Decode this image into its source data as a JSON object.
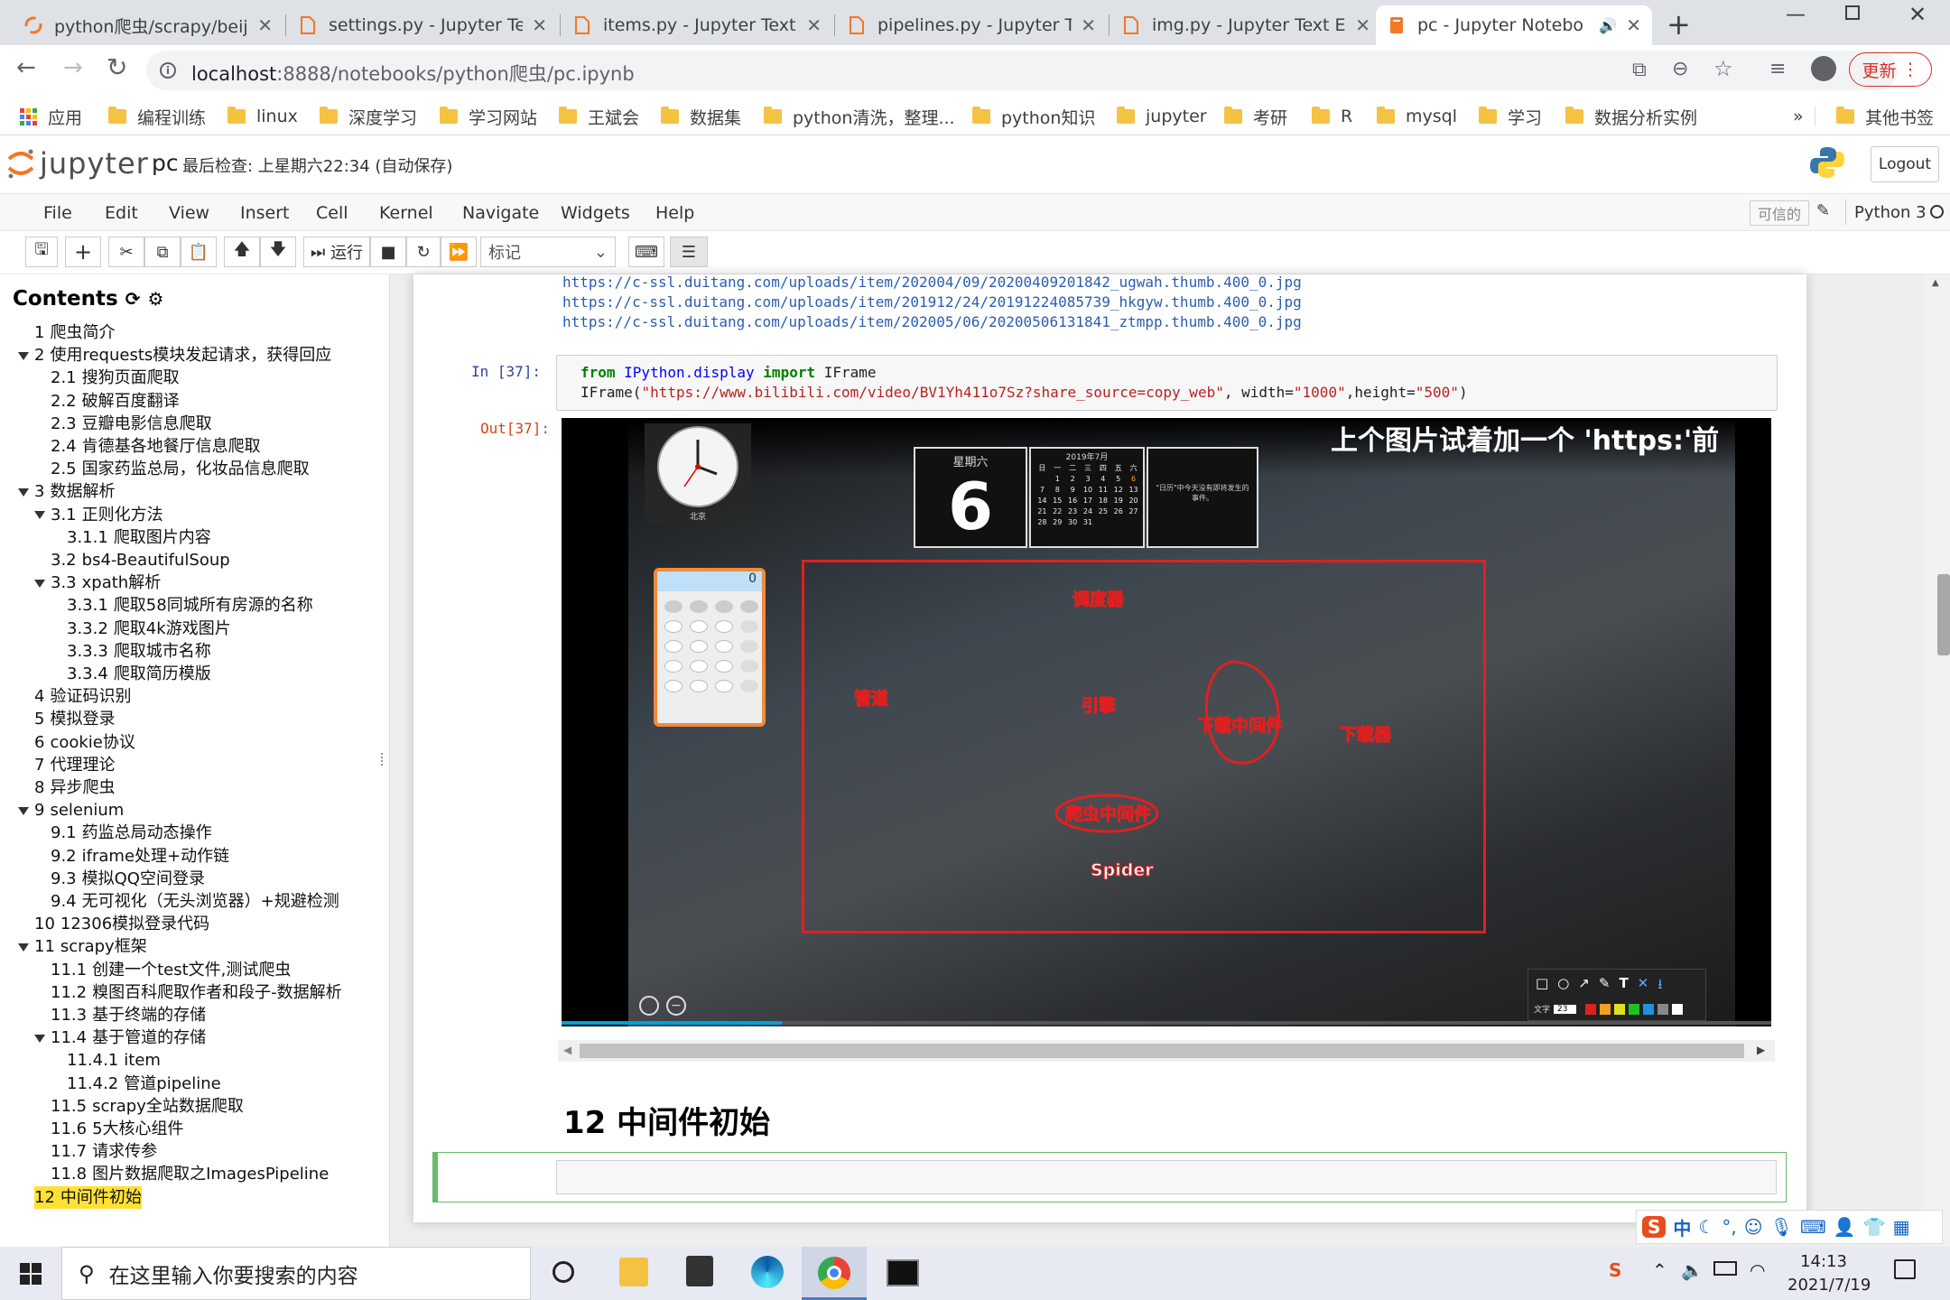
{
  "browser": {
    "tabs": [
      {
        "title": "python爬虫/scrapy/beiji",
        "icon": "jupyter-tab-icon"
      },
      {
        "title": "settings.py - Jupyter Tex",
        "icon": "file-tab-icon"
      },
      {
        "title": "items.py - Jupyter Text E",
        "icon": "file-tab-icon"
      },
      {
        "title": "pipelines.py - Jupyter Te",
        "icon": "file-tab-icon"
      },
      {
        "title": "img.py - Jupyter Text Ec",
        "icon": "file-tab-icon"
      },
      {
        "title": "pc - Jupyter Notebo",
        "icon": "notebook-tab-icon",
        "active": true
      }
    ],
    "new_tab": "+",
    "url_host": "localhost",
    "url_path": ":8888/notebooks/python爬虫/pc.ipynb",
    "update_button": "更新",
    "bookmarks": [
      "应用",
      "编程训练",
      "linux",
      "深度学习",
      "学习网站",
      "王斌会",
      "数据集",
      "python清洗，整理...",
      "python知识",
      "jupyter",
      "考研",
      "R",
      "mysql",
      "学习",
      "数据分析实例"
    ],
    "more_bookmarks": "»",
    "other_bookmarks": "其他书签"
  },
  "jupyter": {
    "logo_text": "jupyter",
    "notebook_name": "pc",
    "checkpoint": "最后检查: 上星期六22:34",
    "autosave": "(自动保存)",
    "logout": "Logout",
    "menu": [
      "File",
      "Edit",
      "View",
      "Insert",
      "Cell",
      "Kernel",
      "Navigate",
      "Widgets",
      "Help"
    ],
    "trusted": "可信的",
    "kernel": "Python 3",
    "run_label": "运行",
    "cell_type": "标记"
  },
  "toc": {
    "title": "Contents",
    "items": [
      {
        "num": "1",
        "label": "爬虫简介",
        "level": 0
      },
      {
        "num": "2",
        "label": "使用requests模块发起请求，获得回应",
        "level": 0,
        "expanded": true
      },
      {
        "num": "2.1",
        "label": "搜狗页面爬取",
        "level": 1
      },
      {
        "num": "2.2",
        "label": "破解百度翻译",
        "level": 1
      },
      {
        "num": "2.3",
        "label": "豆瓣电影信息爬取",
        "level": 1
      },
      {
        "num": "2.4",
        "label": "肯德基各地餐厅信息爬取",
        "level": 1
      },
      {
        "num": "2.5",
        "label": "国家药监总局，化妆品信息爬取",
        "level": 1
      },
      {
        "num": "3",
        "label": "数据解析",
        "level": 0,
        "expanded": true
      },
      {
        "num": "3.1",
        "label": "正则化方法",
        "level": 1,
        "expanded": true
      },
      {
        "num": "3.1.1",
        "label": "爬取图片内容",
        "level": 2
      },
      {
        "num": "3.2",
        "label": "bs4-BeautifulSoup",
        "level": 1
      },
      {
        "num": "3.3",
        "label": "xpath解析",
        "level": 1,
        "expanded": true
      },
      {
        "num": "3.3.1",
        "label": "爬取58同城所有房源的名称",
        "level": 2
      },
      {
        "num": "3.3.2",
        "label": "爬取4k游戏图片",
        "level": 2
      },
      {
        "num": "3.3.3",
        "label": "爬取城市名称",
        "level": 2
      },
      {
        "num": "3.3.4",
        "label": "爬取简历模版",
        "level": 2
      },
      {
        "num": "4",
        "label": "验证码识别",
        "level": 0
      },
      {
        "num": "5",
        "label": "模拟登录",
        "level": 0
      },
      {
        "num": "6",
        "label": "cookie协议",
        "level": 0
      },
      {
        "num": "7",
        "label": "代理理论",
        "level": 0
      },
      {
        "num": "8",
        "label": "异步爬虫",
        "level": 0
      },
      {
        "num": "9",
        "label": "selenium",
        "level": 0,
        "expanded": true
      },
      {
        "num": "9.1",
        "label": "药监总局动态操作",
        "level": 1
      },
      {
        "num": "9.2",
        "label": "iframe处理+动作链",
        "level": 1
      },
      {
        "num": "9.3",
        "label": "模拟QQ空间登录",
        "level": 1
      },
      {
        "num": "9.4",
        "label": "无可视化（无头浏览器）+规避检测",
        "level": 1
      },
      {
        "num": "10",
        "label": "12306模拟登录代码",
        "level": 0
      },
      {
        "num": "11",
        "label": "scrapy框架",
        "level": 0,
        "expanded": true
      },
      {
        "num": "11.1",
        "label": "创建一个test文件,测试爬虫",
        "level": 1
      },
      {
        "num": "11.2",
        "label": "糗图百科爬取作者和段子-数据解析",
        "level": 1
      },
      {
        "num": "11.3",
        "label": "基于终端的存储",
        "level": 1
      },
      {
        "num": "11.4",
        "label": "基于管道的存储",
        "level": 1,
        "expanded": true
      },
      {
        "num": "11.4.1",
        "label": "item",
        "level": 2
      },
      {
        "num": "11.4.2",
        "label": "管道pipeline",
        "level": 2
      },
      {
        "num": "11.5",
        "label": "scrapy全站数据爬取",
        "level": 1
      },
      {
        "num": "11.6",
        "label": "5大核心组件",
        "level": 1
      },
      {
        "num": "11.7",
        "label": "请求传参",
        "level": 1
      },
      {
        "num": "11.8",
        "label": "图片数据爬取之ImagesPipeline",
        "level": 1
      },
      {
        "num": "12",
        "label": "中间件初始",
        "level": 0,
        "highlight": true
      }
    ]
  },
  "notebook": {
    "output_links": [
      "https://c-ssl.duitang.com/uploads/item/202004/09/20200409201842_ugwah.thumb.400_0.jpg",
      "https://c-ssl.duitang.com/uploads/item/201912/24/20191224085739_hkgyw.thumb.400_0.jpg",
      "https://c-ssl.duitang.com/uploads/item/202005/06/20200506131841_ztmpp.thumb.400_0.jpg"
    ],
    "in_prompt": "In  [37]:",
    "out_prompt": "Out[37]:",
    "code_kw_from": "from",
    "code_mod": " IPython.display ",
    "code_kw_import": "import",
    "code_cls": " IFrame",
    "code_line2_a": "IFrame(",
    "code_line2_str": "\"https://www.bilibili.com/video/BV1Yh411o7Sz?share_source=copy_web\"",
    "code_line2_b": ", width=",
    "code_line2_w": "\"1000\"",
    "code_line2_c": ",height=",
    "code_line2_h": "\"500\"",
    "code_line2_d": ")",
    "heading": "12  中间件初始",
    "video": {
      "caption": "上个图片试着加一个 'https:'前",
      "weekday": "星期六",
      "day": "6",
      "calendar_title": "2019年7月",
      "calendar_days": [
        "日",
        "一",
        "二",
        "三",
        "四",
        "五",
        "六",
        "",
        "1",
        "2",
        "3",
        "4",
        "5",
        "6",
        "7",
        "8",
        "9",
        "10",
        "11",
        "12",
        "13",
        "14",
        "15",
        "16",
        "17",
        "18",
        "19",
        "20",
        "21",
        "22",
        "23",
        "24",
        "25",
        "26",
        "27",
        "28",
        "29",
        "30",
        "31"
      ],
      "calendar_note": "\"日历\"中今天没有即将发生的事件。",
      "clock_city": "北京",
      "calc_display": "0",
      "labels": {
        "scheduler": "调度器",
        "pipeline": "管道",
        "engine": "引擎",
        "downloader_mw": "下载中间件",
        "downloader": "下载器",
        "spider_mw": "爬虫中间件",
        "spider": "Spider"
      },
      "draw_tool_text": "文字",
      "draw_tool_size": "23"
    }
  },
  "taskbar": {
    "search_placeholder": "在这里输入你要搜索的内容",
    "time": "14:13",
    "date": "2021/7/19",
    "ime": "中"
  }
}
